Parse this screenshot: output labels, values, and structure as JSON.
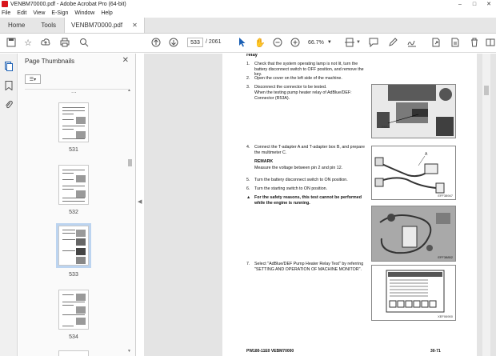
{
  "window": {
    "title": "VENBM70000.pdf - Adobe Acrobat Pro (64-bit)"
  },
  "menu": [
    "File",
    "Edit",
    "View",
    "E-Sign",
    "Window",
    "Help"
  ],
  "tabs": {
    "home": "Home",
    "tools": "Tools",
    "document": "VENBM70000.pdf"
  },
  "toolbar": {
    "page_current": "533",
    "page_total": "/ 2061",
    "zoom": "66.7%"
  },
  "panel": {
    "title": "Page Thumbnails",
    "dots": "...",
    "thumbs": [
      {
        "label": "531",
        "selected": false
      },
      {
        "label": "532",
        "selected": false
      },
      {
        "label": "533",
        "selected": true
      },
      {
        "label": "534",
        "selected": false
      }
    ]
  },
  "page": {
    "heading": "relay",
    "steps": [
      {
        "num": "1.",
        "text": "Check that the system operating lamp is not lit, turn the battery disconnect switch to OFF position, and remove the key."
      },
      {
        "num": "2.",
        "text": "Open the cover on the left side of the machine."
      },
      {
        "num": "3.",
        "text": "Disconnect the connector to be tested."
      },
      {
        "num": "",
        "text": "When the testing pump heater relay of AdBlue/DEF: Connector (R53A)."
      },
      {
        "num": "4.",
        "text": "Connect the T-adapter A and T-adapter box B, and prepare the multimeter C."
      },
      {
        "num": "5.",
        "text": "Turn the battery disconnect switch to ON position."
      },
      {
        "num": "6.",
        "text": "Turn the starting switch to ON position."
      },
      {
        "num": "7.",
        "text": "Select \"AdBlue/DEF Pump Heater Relay Test\" by referring \"SETTING AND OPERATION OF MACHINE MONITOR\"."
      }
    ],
    "remark_title": "REMARK",
    "remark_text": "Measure the voltage between pin 2 and pin 12.",
    "warning": "For the safety reasons, this test cannot be performed while the engine is running.",
    "fig_labels": {
      "connector": "R53A",
      "fig2": "EFF38947",
      "fig3": "EFF38852",
      "fig4": "XEF06900"
    },
    "footer_left": "PW180-11E0    VEBM70000",
    "footer_right": "30-71"
  }
}
